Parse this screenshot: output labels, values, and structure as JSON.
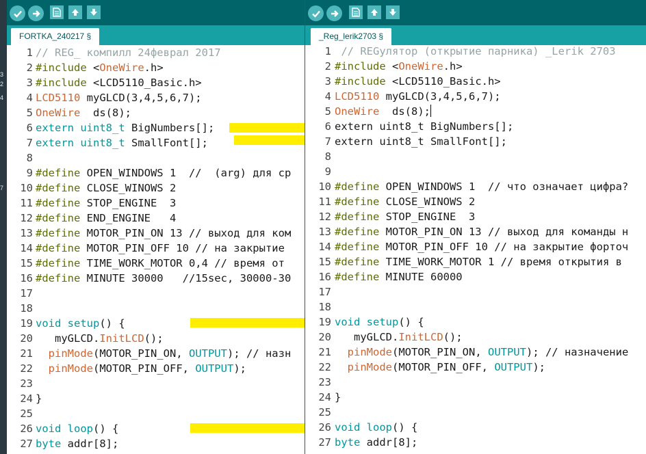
{
  "background": {
    "fragments": [
      "3",
      "2",
      "4",
      "7"
    ]
  },
  "left_window": {
    "tab_label": "FORTKA_240217 §",
    "lines": [
      {
        "n": "1",
        "segments": [
          [
            "cm",
            "// REG_ компилл 24феврал 2017"
          ]
        ]
      },
      {
        "n": "2",
        "segments": [
          [
            "def",
            "#include "
          ],
          [
            "plain",
            "<"
          ],
          [
            "ty",
            "OneWire"
          ],
          [
            "plain",
            ".h>"
          ]
        ]
      },
      {
        "n": "3",
        "segments": [
          [
            "def",
            "#include "
          ],
          [
            "plain",
            "<LCD5110_Basic.h>"
          ]
        ]
      },
      {
        "n": "4",
        "segments": [
          [
            "ty",
            "LCD5110"
          ],
          [
            "plain",
            " myGLCD(3,4,5,6,7);"
          ]
        ]
      },
      {
        "n": "5",
        "segments": [
          [
            "ty",
            "OneWire"
          ],
          [
            "plain",
            "  ds(8);"
          ]
        ]
      },
      {
        "n": "6",
        "segments": [
          [
            "kw",
            "extern uint8_t"
          ],
          [
            "plain",
            " BigNumbers[];"
          ]
        ]
      },
      {
        "n": "7",
        "segments": [
          [
            "kw",
            "extern uint8_t"
          ],
          [
            "plain",
            " SmallFont[];"
          ]
        ]
      },
      {
        "n": "8",
        "segments": []
      },
      {
        "n": "9",
        "segments": [
          [
            "def",
            "#define"
          ],
          [
            "plain",
            " OPEN_WINDOWS 1  //  (arg) для ср"
          ]
        ]
      },
      {
        "n": "10",
        "segments": [
          [
            "def",
            "#define"
          ],
          [
            "plain",
            " CLOSE_WINOWS 2"
          ]
        ]
      },
      {
        "n": "11",
        "segments": [
          [
            "def",
            "#define"
          ],
          [
            "plain",
            " STOP_ENGINE  3"
          ]
        ]
      },
      {
        "n": "12",
        "segments": [
          [
            "def",
            "#define"
          ],
          [
            "plain",
            " END_ENGINE   4"
          ]
        ]
      },
      {
        "n": "13",
        "segments": [
          [
            "def",
            "#define"
          ],
          [
            "plain",
            " MOTOR_PIN_ON 13 // выход для ком"
          ]
        ]
      },
      {
        "n": "14",
        "segments": [
          [
            "def",
            "#define"
          ],
          [
            "plain",
            " MOTOR_PIN_OFF 10 // на закрытие"
          ]
        ]
      },
      {
        "n": "15",
        "segments": [
          [
            "def",
            "#define"
          ],
          [
            "plain",
            " TIME_WORK_MOTOR 0,4 // время от"
          ]
        ]
      },
      {
        "n": "16",
        "segments": [
          [
            "def",
            "#define"
          ],
          [
            "plain",
            " MINUTE 30000   //15sec, 30000-30"
          ]
        ]
      },
      {
        "n": "17",
        "segments": []
      },
      {
        "n": "18",
        "segments": []
      },
      {
        "n": "19",
        "segments": [
          [
            "kw",
            "void"
          ],
          [
            "plain",
            " "
          ],
          [
            "kw",
            "setup"
          ],
          [
            "plain",
            "() {"
          ]
        ]
      },
      {
        "n": "20",
        "segments": [
          [
            "plain",
            "   myGLCD."
          ],
          [
            "ty",
            "InitLCD"
          ],
          [
            "plain",
            "();"
          ]
        ]
      },
      {
        "n": "21",
        "segments": [
          [
            "plain",
            "  "
          ],
          [
            "ty",
            "pinMode"
          ],
          [
            "plain",
            "(MOTOR_PIN_ON, "
          ],
          [
            "kw",
            "OUTPUT"
          ],
          [
            "plain",
            "); // назн"
          ]
        ]
      },
      {
        "n": "22",
        "segments": [
          [
            "plain",
            "  "
          ],
          [
            "ty",
            "pinMode"
          ],
          [
            "plain",
            "(MOTOR_PIN_OFF, "
          ],
          [
            "kw",
            "OUTPUT"
          ],
          [
            "plain",
            ");"
          ]
        ]
      },
      {
        "n": "23",
        "segments": []
      },
      {
        "n": "24",
        "segments": [
          [
            "plain",
            "}"
          ]
        ]
      },
      {
        "n": "25",
        "segments": []
      },
      {
        "n": "26",
        "segments": [
          [
            "kw",
            "void"
          ],
          [
            "plain",
            " "
          ],
          [
            "kw",
            "loop"
          ],
          [
            "plain",
            "() {"
          ]
        ]
      },
      {
        "n": "27",
        "segments": [
          [
            "kw",
            "byte"
          ],
          [
            "plain",
            " addr[8];"
          ]
        ]
      }
    ]
  },
  "right_window": {
    "tab_label": "_Reg_lerik2703 §",
    "lines": [
      {
        "n": "1",
        "segments": [
          [
            "cm",
            " // REGулятор (открытие парника) _Lerik 2703"
          ]
        ]
      },
      {
        "n": "2",
        "segments": [
          [
            "def",
            "#include "
          ],
          [
            "plain",
            "<"
          ],
          [
            "ty",
            "OneWire"
          ],
          [
            "plain",
            ".h>"
          ]
        ]
      },
      {
        "n": "3",
        "segments": [
          [
            "def",
            "#include "
          ],
          [
            "plain",
            "<LCD5110_Basic.h>"
          ]
        ]
      },
      {
        "n": "4",
        "segments": [
          [
            "ty",
            "LCD5110"
          ],
          [
            "plain",
            " myGLCD(3,4,5,6,7);"
          ]
        ]
      },
      {
        "n": "5",
        "segments": [
          [
            "ty",
            "OneWire"
          ],
          [
            "plain",
            "  ds(8);"
          ]
        ]
      },
      {
        "n": "6",
        "segments": [
          [
            "plain",
            "extern uint8_t BigNumbers[];"
          ]
        ]
      },
      {
        "n": "7",
        "segments": [
          [
            "plain",
            "extern uint8_t SmallFont[];"
          ]
        ]
      },
      {
        "n": "8",
        "segments": []
      },
      {
        "n": "9",
        "segments": []
      },
      {
        "n": "10",
        "segments": [
          [
            "def",
            "#define"
          ],
          [
            "plain",
            " OPEN_WINDOWS 1  // что означает цифра?"
          ]
        ]
      },
      {
        "n": "11",
        "segments": [
          [
            "def",
            "#define"
          ],
          [
            "plain",
            " CLOSE_WINOWS 2"
          ]
        ]
      },
      {
        "n": "12",
        "segments": [
          [
            "def",
            "#define"
          ],
          [
            "plain",
            " STOP_ENGINE  3"
          ]
        ]
      },
      {
        "n": "13",
        "segments": [
          [
            "def",
            "#define"
          ],
          [
            "plain",
            " MOTOR_PIN_ON 13 // выход для команды н"
          ]
        ]
      },
      {
        "n": "14",
        "segments": [
          [
            "def",
            "#define"
          ],
          [
            "plain",
            " MOTOR_PIN_OFF 10 // на закрытие форточ"
          ]
        ]
      },
      {
        "n": "15",
        "segments": [
          [
            "def",
            "#define"
          ],
          [
            "plain",
            " TIME_WORK_MOTOR 1 // время открытия в"
          ]
        ]
      },
      {
        "n": "16",
        "segments": [
          [
            "def",
            "#define"
          ],
          [
            "plain",
            " MINUTE 60000"
          ]
        ]
      },
      {
        "n": "17",
        "segments": []
      },
      {
        "n": "18",
        "segments": []
      },
      {
        "n": "19",
        "segments": [
          [
            "kw",
            "void"
          ],
          [
            "plain",
            " "
          ],
          [
            "kw",
            "setup"
          ],
          [
            "plain",
            "() {"
          ]
        ]
      },
      {
        "n": "20",
        "segments": [
          [
            "plain",
            "   myGLCD."
          ],
          [
            "ty",
            "InitLCD"
          ],
          [
            "plain",
            "();"
          ]
        ]
      },
      {
        "n": "21",
        "segments": [
          [
            "plain",
            "  "
          ],
          [
            "ty",
            "pinMode"
          ],
          [
            "plain",
            "(MOTOR_PIN_ON, "
          ],
          [
            "kw",
            "OUTPUT"
          ],
          [
            "plain",
            "); // назначение"
          ]
        ]
      },
      {
        "n": "22",
        "segments": [
          [
            "plain",
            "  "
          ],
          [
            "ty",
            "pinMode"
          ],
          [
            "plain",
            "(MOTOR_PIN_OFF, "
          ],
          [
            "kw",
            "OUTPUT"
          ],
          [
            "plain",
            ");"
          ]
        ]
      },
      {
        "n": "23",
        "segments": []
      },
      {
        "n": "24",
        "segments": [
          [
            "plain",
            "}"
          ]
        ]
      },
      {
        "n": "25",
        "segments": []
      },
      {
        "n": "26",
        "segments": [
          [
            "kw",
            "void"
          ],
          [
            "plain",
            " "
          ],
          [
            "kw",
            "loop"
          ],
          [
            "plain",
            "() {"
          ]
        ]
      },
      {
        "n": "27",
        "segments": [
          [
            "kw",
            "byte"
          ],
          [
            "plain",
            " addr[8];"
          ]
        ]
      }
    ]
  },
  "toolbar_icons": [
    "verify-icon",
    "upload-icon",
    "new-icon",
    "open-icon",
    "save-icon"
  ],
  "colors": {
    "toolbar": "#006468",
    "tabbar": "#17a1a5",
    "button": "#4db7bb",
    "keyword": "#00979d",
    "type": "#cc6633",
    "comment": "#95a5a6",
    "define": "#5e6d03",
    "highlight": "#ffee00"
  }
}
